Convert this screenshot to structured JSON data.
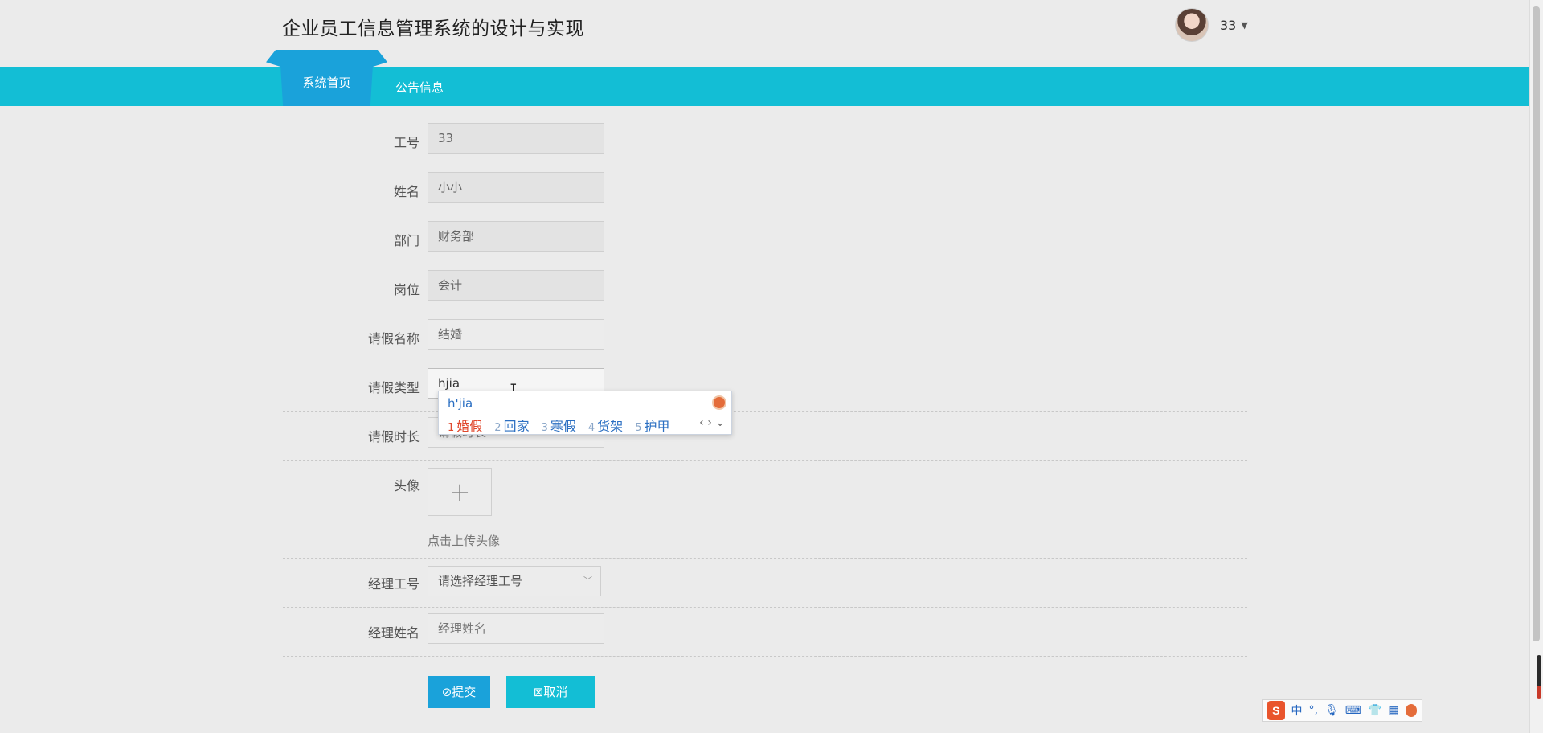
{
  "app": {
    "title": "企业员工信息管理系统的设计与实现",
    "user_name": "33"
  },
  "nav": {
    "tabs": [
      {
        "label": "系统首页",
        "active": true
      },
      {
        "label": "公告信息",
        "active": false
      }
    ]
  },
  "form": {
    "employee_id": {
      "label": "工号",
      "value": "33"
    },
    "name": {
      "label": "姓名",
      "value": "小小"
    },
    "department": {
      "label": "部门",
      "value": "财务部"
    },
    "position": {
      "label": "岗位",
      "value": "会计"
    },
    "leave_name": {
      "label": "请假名称",
      "value": "结婚"
    },
    "leave_type": {
      "label": "请假类型",
      "value": "hjia"
    },
    "leave_duration": {
      "label": "请假时长",
      "placeholder": "请假时长"
    },
    "avatar": {
      "label": "头像",
      "upload_hint": "点击上传头像"
    },
    "manager_id": {
      "label": "经理工号",
      "placeholder": "请选择经理工号"
    },
    "manager_name": {
      "label": "经理姓名",
      "placeholder": "经理姓名"
    },
    "submit_label": "提交",
    "cancel_label": "取消"
  },
  "ime_popup": {
    "composition": "h'jia",
    "candidates": [
      {
        "num": "1",
        "text": "婚假"
      },
      {
        "num": "2",
        "text": "回家"
      },
      {
        "num": "3",
        "text": "寒假"
      },
      {
        "num": "4",
        "text": "货架"
      },
      {
        "num": "5",
        "text": "护甲"
      }
    ]
  },
  "ime_toolbar": {
    "mode": "中",
    "punct": "°,"
  },
  "colors": {
    "nav_bar": "#13bed5",
    "nav_active": "#1aa2da",
    "submit": "#1aa2da",
    "cancel": "#13bed5"
  }
}
